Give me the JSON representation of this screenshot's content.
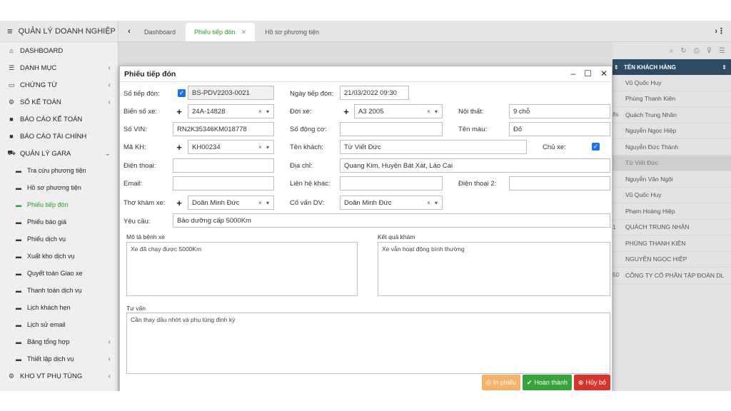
{
  "app": {
    "title": "QUẢN LÝ DOANH NGHIỆP"
  },
  "sidebar": {
    "items": [
      {
        "label": "DASHBOARD",
        "icon": "home-icon",
        "chevron": false
      },
      {
        "label": "DANH MỤC",
        "icon": "list-icon",
        "chevron": true
      },
      {
        "label": "CHỨNG TỪ",
        "icon": "card-icon",
        "chevron": true
      },
      {
        "label": "SỔ KẾ TOÁN",
        "icon": "gear-icon",
        "chevron": true
      },
      {
        "label": "BÁO CÁO KẾ TOÁN",
        "icon": "folder-icon",
        "chevron": false
      },
      {
        "label": "BÁO CÁO TÀI CHÍNH",
        "icon": "folder-icon",
        "chevron": false
      },
      {
        "label": "QUẢN LÝ GARA",
        "icon": "car-icon",
        "chevron": true
      }
    ],
    "gara_items": [
      {
        "label": "Tra cứu phương tiện",
        "active": false
      },
      {
        "label": "Hồ sơ phương tiện",
        "active": false
      },
      {
        "label": "Phiếu tiếp đón",
        "active": true
      },
      {
        "label": "Phiếu báo giá",
        "active": false
      },
      {
        "label": "Phiếu dịch vụ",
        "active": false
      },
      {
        "label": "Xuất kho dịch vụ",
        "active": false
      },
      {
        "label": "Quyết toán Giao xe",
        "active": false
      },
      {
        "label": "Thanh toán dịch vụ",
        "active": false
      },
      {
        "label": "Lịch khách hẹn",
        "active": false
      },
      {
        "label": "Lịch sử email",
        "active": false
      },
      {
        "label": "Bảng tổng hợp",
        "active": false,
        "chevron": true
      },
      {
        "label": "Thiết lập dịch vụ",
        "active": false,
        "chevron": true
      }
    ],
    "last_item": {
      "label": "KHO VT PHỤ TÙNG",
      "icon": "settings-icon"
    }
  },
  "tabs": [
    {
      "label": "Dashboard",
      "active": false
    },
    {
      "label": "Phiếu tiếp đón",
      "active": true
    },
    {
      "label": "Hồ sơ phương tiện",
      "active": false
    }
  ],
  "grid": {
    "header": "TÊN KHÁCH HÀNG",
    "rows": [
      {
        "prefix": "",
        "name": "Vũ Quốc Huy"
      },
      {
        "prefix": "",
        "name": "Phùng Thanh Kiên"
      },
      {
        "prefix": "8s",
        "name": "Quách Trung Nhân"
      },
      {
        "prefix": "",
        "name": "Nguyễn Ngọc Hiệp"
      },
      {
        "prefix": "",
        "name": "Nguyễn Đức Thành"
      },
      {
        "prefix": "",
        "name": "Từ Viết Đức",
        "selected": true
      },
      {
        "prefix": "",
        "name": "Nguyễn Văn Ngôi"
      },
      {
        "prefix": "",
        "name": "Vũ Quốc Huy"
      },
      {
        "prefix": "",
        "name": "Phạm Hoàng Hiệp"
      },
      {
        "prefix": "1",
        "name": "QUÁCH TRUNG NHÂN"
      },
      {
        "prefix": "",
        "name": "PHÙNG THANH KIÊN"
      },
      {
        "prefix": "",
        "name": "NGUYỄN NGỌC HIỆP"
      },
      {
        "prefix": "50",
        "name": "CÔNG TY CỔ PHẦN TẬP ĐOÀN DL"
      }
    ]
  },
  "modal": {
    "title": "Phiếu tiếp đón",
    "labels": {
      "so_tiep_don": "Số tiếp đón:",
      "ngay_tiep_don": "Ngày tiếp đón:",
      "bien_so_xe": "Biển số xe:",
      "doi_xe": "Đời xe:",
      "noi_that": "Nội thất:",
      "so_vin": "Số VIN:",
      "so_dong_co": "Số động cơ:",
      "ten_mau": "Tên màu:",
      "ma_kh": "Mã KH:",
      "ten_khach": "Tên khách:",
      "chu_xe": "Chủ xe:",
      "dien_thoai": "Điện thoại:",
      "dia_chi": "Địa chỉ:",
      "email": "Email:",
      "lien_he_khac": "Liên hệ khác:",
      "dien_thoai_2": "Điện thoại 2:",
      "tho_kham_xe": "Thợ khám xe:",
      "co_van_dv": "Cố vấn DV:",
      "yeu_cau": "Yêu cầu:"
    },
    "values": {
      "so_tiep_don": "BS-PDV2203-0021",
      "ngay_tiep_don": "21/03/2022 09:30",
      "bien_so_xe": "24A-14828",
      "doi_xe": "A3 2005",
      "noi_that": "9 chỗ",
      "so_vin": "RN2K35346KM018778",
      "so_dong_co": "",
      "ten_mau": "Đỏ",
      "ma_kh": "KH00234",
      "ten_khach": "Từ Viết Đức",
      "dien_thoai": "",
      "dia_chi": "Quang Kim, Huyện Bát Xát, Lào Cai",
      "email": "",
      "lien_he_khac": "",
      "dien_thoai_2": "",
      "tho_kham_xe": "Doãn Minh Đức",
      "co_van_dv": "Doãn Minh Đức",
      "yeu_cau": "Bảo dưỡng cấp 5000Km"
    },
    "sections": {
      "mo_ta_title": "Mô tả bệnh xe",
      "mo_ta_value": "Xe đã chạy được 5000Km",
      "ket_qua_title": "Kết quả khám",
      "ket_qua_value": "Xe vẫn hoạt động bình thường",
      "tu_van_title": "Tư vấn",
      "tu_van_value": "Cần thay dầu nhớt và phụ tùng định kỳ"
    },
    "buttons": {
      "print": "In phiếu",
      "done": "Hoàn thành",
      "cancel": "Hủy bỏ"
    }
  },
  "colors": {
    "accent_green": "#2e9c2e",
    "grid_header": "#2d4a63",
    "checkbox_blue": "#1a73e8",
    "btn_print": "#f6b26b",
    "btn_done": "#36a33a",
    "btn_cancel": "#d9342b"
  }
}
